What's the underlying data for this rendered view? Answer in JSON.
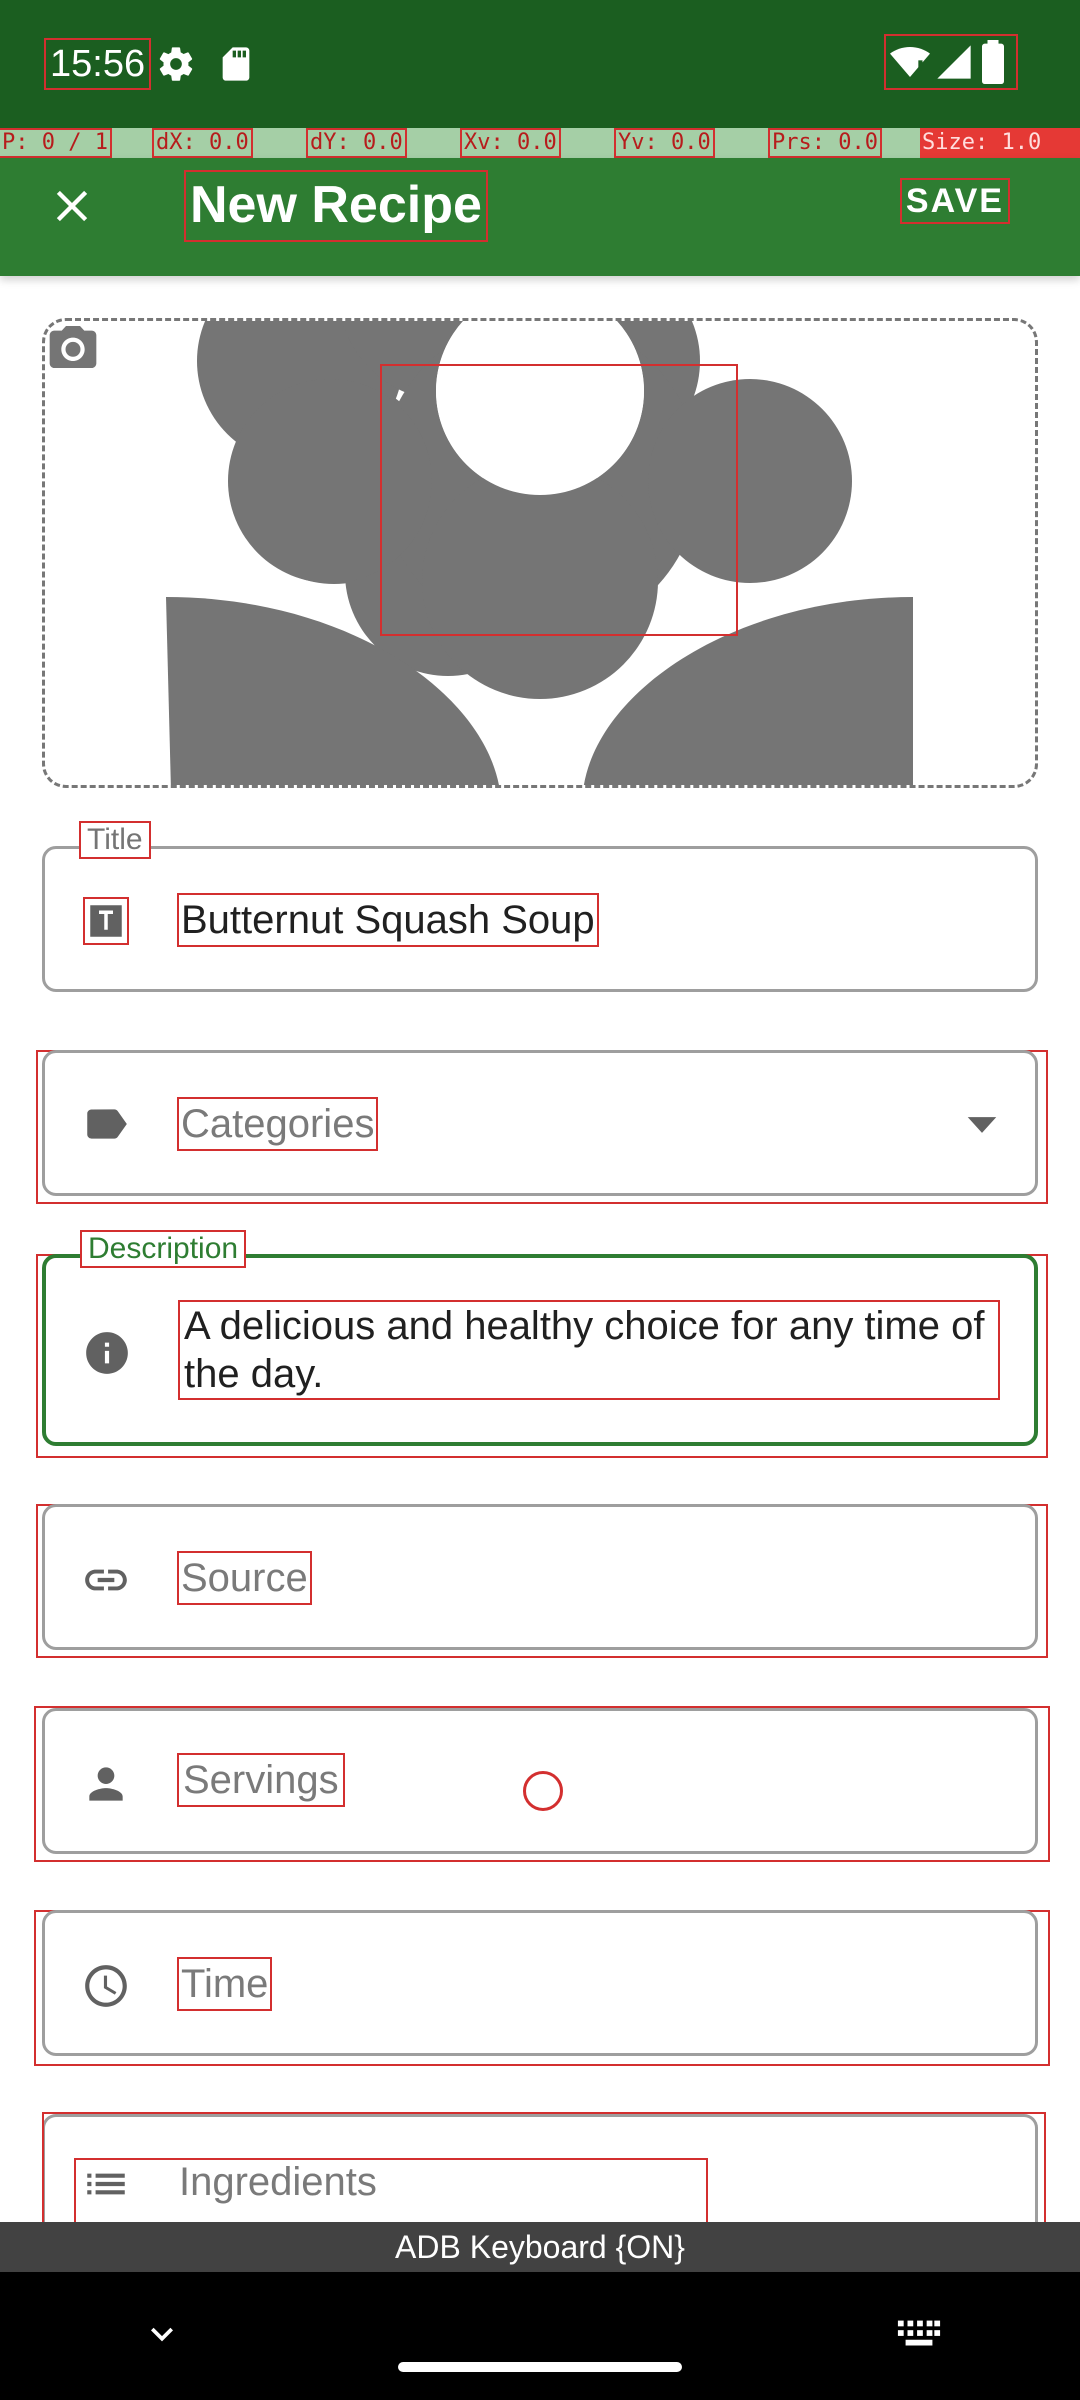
{
  "status_bar": {
    "time": "15:56",
    "icons": [
      "settings-gear-icon",
      "sd-card-icon",
      "wifi-icon",
      "signal-icon",
      "battery-icon"
    ]
  },
  "pointer_overlay": {
    "p": "P: 0 / 1",
    "dx": "dX: 0.0",
    "dy": "dY: 0.0",
    "xv": "Xv: 0.0",
    "yv": "Yv: 0.0",
    "prs": "Prs: 0.0",
    "size": "Size: 1.0"
  },
  "app_bar": {
    "title": "New Recipe",
    "save_label": "SAVE",
    "close_icon": "close-icon"
  },
  "image_picker": {
    "placeholder_icon": "flower-image-icon",
    "camera_icon": "camera-icon"
  },
  "form": {
    "title": {
      "legend": "Title",
      "value": "Butternut Squash Soup",
      "icon": "text-title-icon"
    },
    "categories": {
      "placeholder": "Categories",
      "icon": "label-tag-icon",
      "dropdown_icon": "dropdown-arrow-icon"
    },
    "description": {
      "legend": "Description",
      "value": "A delicious and healthy choice for any time of the day.",
      "icon": "info-icon"
    },
    "source": {
      "placeholder": "Source",
      "icon": "link-icon"
    },
    "servings": {
      "placeholder": "Servings",
      "icon": "person-icon"
    },
    "time": {
      "placeholder": "Time",
      "icon": "clock-icon"
    },
    "ingredients": {
      "placeholder": "Ingredients",
      "icon": "list-icon"
    }
  },
  "keyboard_bar": {
    "label": "ADB Keyboard {ON}"
  },
  "colors": {
    "status_bar": "#1b5e20",
    "app_bar": "#2e7d32",
    "focused_border": "#2e7d32",
    "debug_outline": "#d32f2f"
  }
}
